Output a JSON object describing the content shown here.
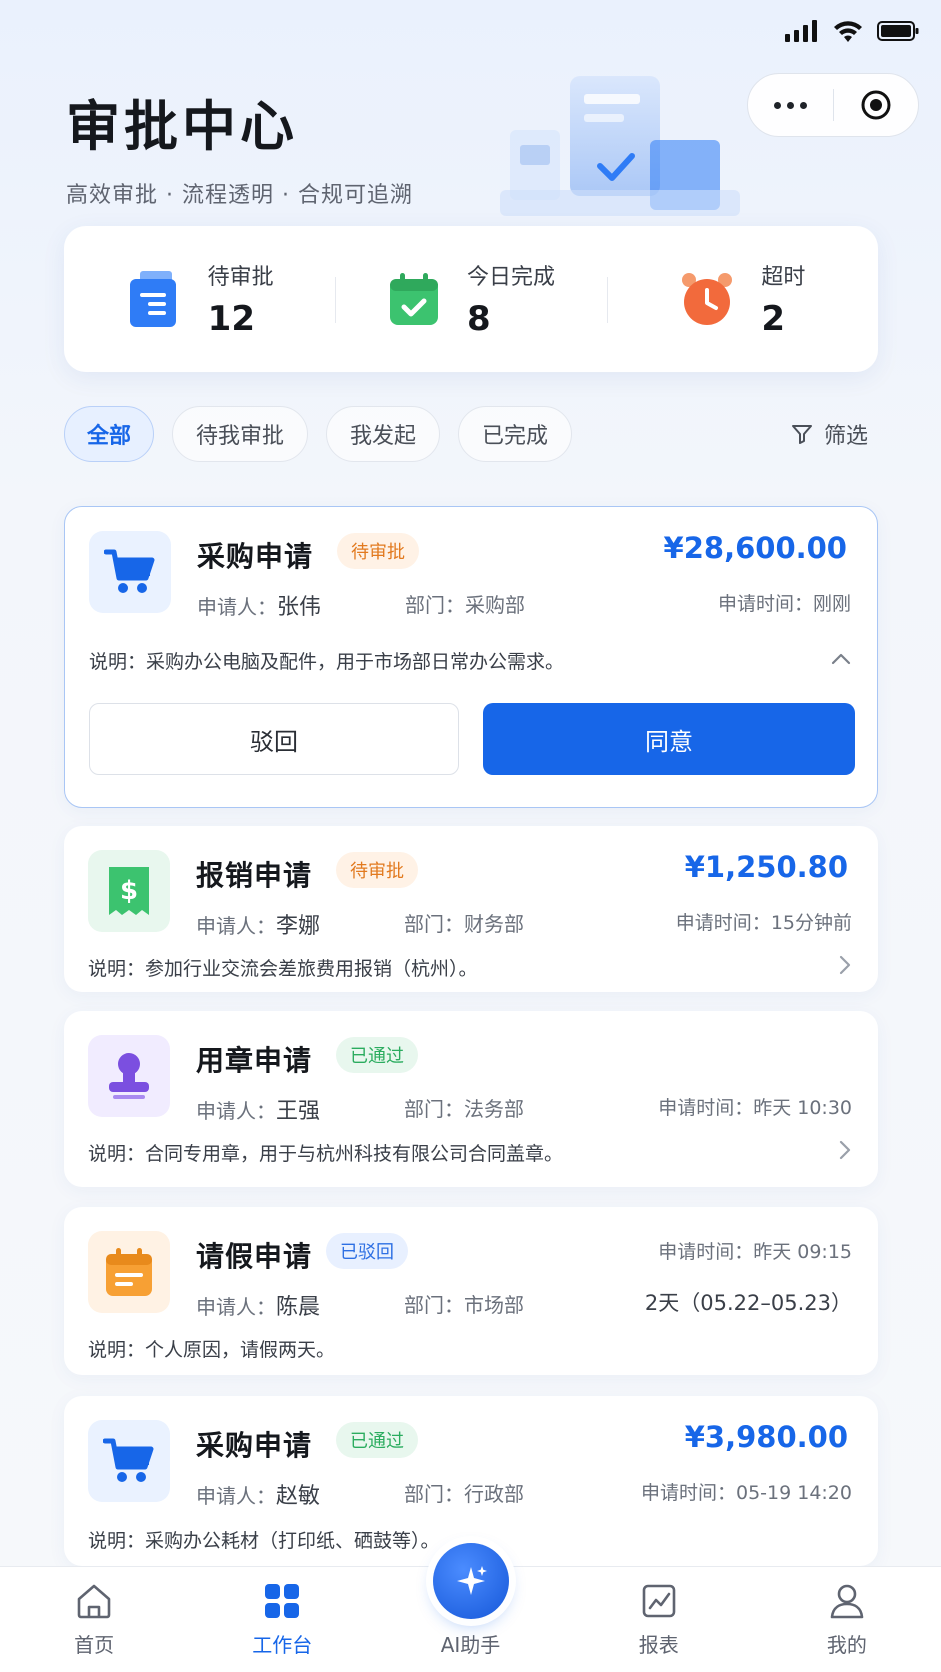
{
  "header": {
    "title": "审批中心",
    "subtitle": "高效审批 · 流程透明 · 合规可追溯"
  },
  "stats": [
    {
      "label": "待审批",
      "value": "12",
      "icon": "pending-doc-icon",
      "color": "#2f7cf6"
    },
    {
      "label": "今日完成",
      "value": "8",
      "icon": "calendar-check-icon",
      "color": "#3cc36f"
    },
    {
      "label": "超时",
      "value": "2",
      "icon": "alarm-clock-icon",
      "color": "#f26a3c"
    }
  ],
  "tabs": [
    "全部",
    "待我审批",
    "我发起",
    "已完成"
  ],
  "filter_label": "筛选",
  "labels": {
    "applicant": "申请人：",
    "department": "部门：",
    "apply_time": "申请时间：",
    "description": "说明："
  },
  "cards": [
    {
      "title": "采购申请",
      "status": "待审批",
      "amount": "¥28,600.00",
      "applicant": "张伟",
      "department": "采购部",
      "time": "刚刚",
      "description": "采购办公电脑及配件，用于市场部日常办公需求。",
      "icon": "shopping-cart-icon",
      "reject_label": "驳回",
      "approve_label": "同意"
    },
    {
      "title": "报销申请",
      "status": "待审批",
      "amount": "¥1,250.80",
      "applicant": "李娜",
      "department": "财务部",
      "time": "15分钟前",
      "description": "参加行业交流会差旅费用报销（杭州）。",
      "icon": "receipt-dollar-icon"
    },
    {
      "title": "用章申请",
      "status": "已通过",
      "applicant": "王强",
      "department": "法务部",
      "time": "昨天 10:30",
      "description": "合同专用章，用于与杭州科技有限公司合同盖章。",
      "icon": "stamp-icon"
    },
    {
      "title": "请假申请",
      "status": "已驳回",
      "applicant": "陈晨",
      "department": "市场部",
      "time": "昨天 09:15",
      "duration": "2天（05.22–05.23）",
      "description": "个人原因，请假两天。",
      "icon": "calendar-icon"
    },
    {
      "title": "采购申请",
      "status": "已通过",
      "amount": "¥3,980.00",
      "applicant": "赵敏",
      "department": "行政部",
      "time": "05-19 14:20",
      "description": "采购办公耗材（打印纸、硒鼓等）。",
      "icon": "shopping-cart-icon"
    }
  ],
  "bottom_nav": [
    {
      "label": "首页",
      "icon": "home-icon"
    },
    {
      "label": "工作台",
      "icon": "grid-icon"
    },
    {
      "label": "AI助手",
      "icon": "sparkle-icon"
    },
    {
      "label": "报表",
      "icon": "chart-icon"
    },
    {
      "label": "我的",
      "icon": "user-icon"
    }
  ],
  "colors": {
    "primary": "#1766e8",
    "pending": "#e27a1f",
    "approved": "#2bac5f",
    "rejected": "#2d6fe3"
  }
}
